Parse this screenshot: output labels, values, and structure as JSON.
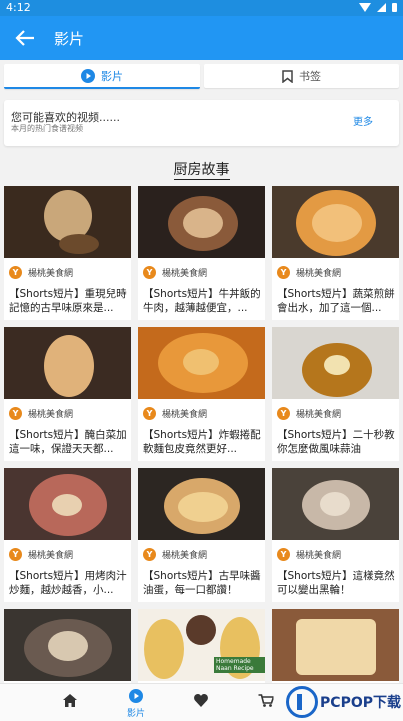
{
  "status_bar": {
    "time": "4:12"
  },
  "app_bar": {
    "title": "影片"
  },
  "tabs": [
    {
      "label": "影片",
      "icon": "play-circle-icon",
      "active": true
    },
    {
      "label": "书签",
      "icon": "bookmark-icon",
      "active": false
    }
  ],
  "suggest": {
    "headline": "您可能喜欢的视频......",
    "subtitle": "本月的热门食谱视频",
    "more_label": "更多"
  },
  "section_title": "厨房故事",
  "colors": {
    "primary": "#2196f3",
    "accent": "#1e88e5"
  },
  "videos": [
    {
      "channel": "楊桃美食網",
      "title": "【Shorts短片】重現兒時記憶的古早味原來是..."
    },
    {
      "channel": "楊桃美食網",
      "title": "【Shorts短片】牛丼飯的牛肉，越薄越便宜，..."
    },
    {
      "channel": "楊桃美食網",
      "title": "【Shorts短片】蔬菜煎餅會出水，加了這一個..."
    },
    {
      "channel": "楊桃美食網",
      "title": "【Shorts短片】醃白菜加這一味，保證天天都..."
    },
    {
      "channel": "楊桃美食網",
      "title": "【Shorts短片】炸蝦捲配軟麵包皮竟然更好..."
    },
    {
      "channel": "楊桃美食網",
      "title": "【Shorts短片】二十秒教你怎麼做風味蒜油"
    },
    {
      "channel": "楊桃美食網",
      "title": "【Shorts短片】用烤肉汁炒麵，越炒越香，小..."
    },
    {
      "channel": "楊桃美食網",
      "title": "【Shorts短片】古早味醬油蛋，每一口都讚！"
    },
    {
      "channel": "楊桃美食網",
      "title": "【Shorts短片】這樣竟然可以變出黑輪！"
    },
    {
      "channel": "",
      "title": ""
    },
    {
      "channel": "",
      "title": "",
      "thumb_text": "Homemade Naan Recipe"
    },
    {
      "channel": "",
      "title": ""
    }
  ],
  "bottom_nav": [
    {
      "icon": "home-icon",
      "label": ""
    },
    {
      "icon": "play-circle-icon",
      "label": "影片",
      "active": true
    },
    {
      "icon": "heart-icon",
      "label": ""
    },
    {
      "icon": "cart-icon",
      "label": ""
    }
  ],
  "watermark": {
    "text": "PCPOP下载"
  }
}
